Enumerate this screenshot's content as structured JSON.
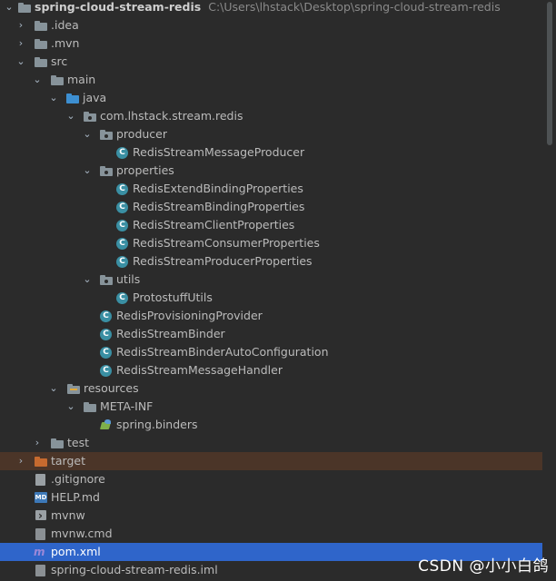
{
  "root": {
    "name": "spring-cloud-stream-redis",
    "path": "C:\\Users\\lhstack\\Desktop\\spring-cloud-stream-redis"
  },
  "tree": [
    {
      "label": "spring-cloud-stream-redis",
      "icon": "folder-module-icon",
      "expanded": true
    },
    {
      "label": ".idea",
      "icon": "folder-icon",
      "expanded": false
    },
    {
      "label": ".mvn",
      "icon": "folder-icon",
      "expanded": false
    },
    {
      "label": "src",
      "icon": "folder-icon",
      "expanded": true
    },
    {
      "label": "main",
      "icon": "folder-icon",
      "expanded": true
    },
    {
      "label": "java",
      "icon": "source-folder-icon",
      "expanded": true
    },
    {
      "label": "com.lhstack.stream.redis",
      "icon": "package-icon",
      "expanded": true
    },
    {
      "label": "producer",
      "icon": "package-icon",
      "expanded": true
    },
    {
      "label": "RedisStreamMessageProducer",
      "icon": "class-icon"
    },
    {
      "label": "properties",
      "icon": "package-icon",
      "expanded": true
    },
    {
      "label": "RedisExtendBindingProperties",
      "icon": "class-icon"
    },
    {
      "label": "RedisStreamBindingProperties",
      "icon": "class-icon"
    },
    {
      "label": "RedisStreamClientProperties",
      "icon": "class-icon"
    },
    {
      "label": "RedisStreamConsumerProperties",
      "icon": "class-icon"
    },
    {
      "label": "RedisStreamProducerProperties",
      "icon": "class-icon"
    },
    {
      "label": "utils",
      "icon": "package-icon",
      "expanded": true
    },
    {
      "label": "ProtostuffUtils",
      "icon": "class-icon"
    },
    {
      "label": "RedisProvisioningProvider",
      "icon": "class-icon"
    },
    {
      "label": "RedisStreamBinder",
      "icon": "class-icon"
    },
    {
      "label": "RedisStreamBinderAutoConfiguration",
      "icon": "class-icon"
    },
    {
      "label": "RedisStreamMessageHandler",
      "icon": "class-icon"
    },
    {
      "label": "resources",
      "icon": "resources-folder-icon",
      "expanded": true
    },
    {
      "label": "META-INF",
      "icon": "folder-icon",
      "expanded": true
    },
    {
      "label": "spring.binders",
      "icon": "spring-file-icon"
    },
    {
      "label": "test",
      "icon": "folder-icon",
      "expanded": false
    },
    {
      "label": "target",
      "icon": "excluded-folder-icon",
      "expanded": false
    },
    {
      "label": ".gitignore",
      "icon": "gitignore-file-icon"
    },
    {
      "label": "HELP.md",
      "icon": "markdown-file-icon"
    },
    {
      "label": "mvnw",
      "icon": "shell-file-icon"
    },
    {
      "label": "mvnw.cmd",
      "icon": "text-file-icon"
    },
    {
      "label": "pom.xml",
      "icon": "maven-pom-icon"
    },
    {
      "label": "spring-cloud-stream-redis.iml",
      "icon": "iml-file-icon"
    }
  ],
  "class_icon_letter": "C",
  "markdown_icon_text": "MD",
  "pom_icon_letter": "m",
  "watermark": "CSDN @小小白鸽",
  "colors": {
    "background": "#2b2b2b",
    "selected_row": "#2f65ca",
    "highlighted_row": "#4b3528",
    "class_icon": "#3a8fa3",
    "source_folder": "#3d8fd1",
    "excluded_folder": "#c66a2f"
  }
}
